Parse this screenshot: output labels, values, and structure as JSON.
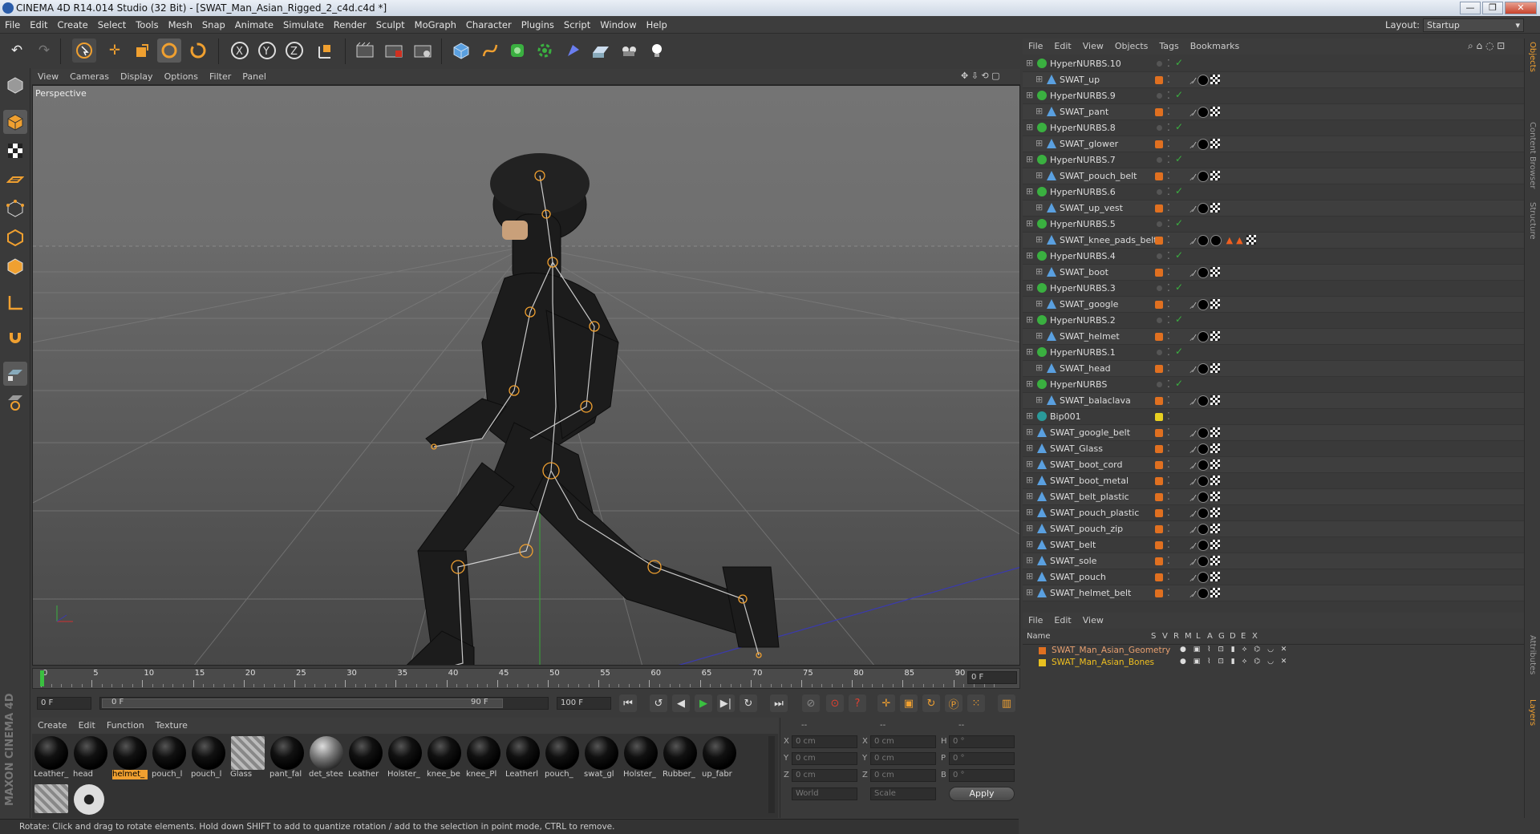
{
  "window": {
    "title": "CINEMA 4D R14.014 Studio (32 Bit) - [SWAT_Man_Asian_Rigged_2_c4d.c4d *]",
    "controls": [
      "—",
      "❐",
      "✕"
    ]
  },
  "menubar": [
    "File",
    "Edit",
    "Create",
    "Select",
    "Tools",
    "Mesh",
    "Snap",
    "Animate",
    "Simulate",
    "Render",
    "Sculpt",
    "MoGraph",
    "Character",
    "Plugins",
    "Script",
    "Window",
    "Help"
  ],
  "layout": {
    "label": "Layout:",
    "value": "Startup"
  },
  "viewport": {
    "menu": [
      "View",
      "Cameras",
      "Display",
      "Options",
      "Filter",
      "Panel"
    ],
    "label": "Perspective"
  },
  "timeline": {
    "ticks": [
      "0",
      "5",
      "10",
      "15",
      "20",
      "25",
      "30",
      "35",
      "40",
      "45",
      "50",
      "55",
      "60",
      "65",
      "70",
      "75",
      "80",
      "85",
      "90"
    ],
    "current_frame": "0 F",
    "start_field": "0 F",
    "range_start": "0 F",
    "range_end": "90 F",
    "end_field": "100 F"
  },
  "materials": {
    "menu": [
      "Create",
      "Edit",
      "Function",
      "Texture"
    ],
    "items": [
      {
        "label": "Leather_"
      },
      {
        "label": "head"
      },
      {
        "label": "helmet_",
        "selected": true
      },
      {
        "label": "pouch_l"
      },
      {
        "label": "pouch_l"
      },
      {
        "label": "Glass"
      },
      {
        "label": "pant_fal"
      },
      {
        "label": "det_stee"
      },
      {
        "label": "Leather"
      },
      {
        "label": "Holster_"
      },
      {
        "label": "knee_be"
      },
      {
        "label": "knee_Pl"
      },
      {
        "label": "Leatherl"
      },
      {
        "label": "pouch_"
      },
      {
        "label": "swat_gl"
      },
      {
        "label": "Holster_"
      },
      {
        "label": "Rubber_"
      },
      {
        "label": "up_fabr"
      }
    ]
  },
  "coords": {
    "headers": [
      "--",
      "--",
      "--"
    ],
    "rows": [
      {
        "a": "X",
        "av": "0 cm",
        "b": "X",
        "bv": "0 cm",
        "c": "H",
        "cv": "0 °"
      },
      {
        "a": "Y",
        "av": "0 cm",
        "b": "Y",
        "bv": "0 cm",
        "c": "P",
        "cv": "0 °"
      },
      {
        "a": "Z",
        "av": "0 cm",
        "b": "Z",
        "bv": "0 cm",
        "c": "B",
        "cv": "0 °"
      }
    ],
    "mode1": "World",
    "mode2": "Scale",
    "apply": "Apply"
  },
  "status": "Rotate: Click and drag to rotate elements. Hold down SHIFT to add to quantize rotation / add to the selection in point mode, CTRL to remove.",
  "object_manager": {
    "menu": [
      "File",
      "Edit",
      "View",
      "Objects",
      "Tags",
      "Bookmarks"
    ],
    "rows": [
      {
        "name": "HyperNURBS.10",
        "type": "nurbs",
        "indent": 0
      },
      {
        "name": "SWAT_up",
        "type": "poly",
        "indent": 1
      },
      {
        "name": "HyperNURBS.9",
        "type": "nurbs",
        "indent": 0
      },
      {
        "name": "SWAT_pant",
        "type": "poly",
        "indent": 1
      },
      {
        "name": "HyperNURBS.8",
        "type": "nurbs",
        "indent": 0
      },
      {
        "name": "SWAT_glower",
        "type": "poly",
        "indent": 1
      },
      {
        "name": "HyperNURBS.7",
        "type": "nurbs",
        "indent": 0
      },
      {
        "name": "SWAT_pouch_belt",
        "type": "poly",
        "indent": 1
      },
      {
        "name": "HyperNURBS.6",
        "type": "nurbs",
        "indent": 0
      },
      {
        "name": "SWAT_up_vest",
        "type": "poly",
        "indent": 1
      },
      {
        "name": "HyperNURBS.5",
        "type": "nurbs",
        "indent": 0
      },
      {
        "name": "SWAT_knee_pads_belt",
        "type": "poly",
        "indent": 1
      },
      {
        "name": "HyperNURBS.4",
        "type": "nurbs",
        "indent": 0
      },
      {
        "name": "SWAT_boot",
        "type": "poly",
        "indent": 1
      },
      {
        "name": "HyperNURBS.3",
        "type": "nurbs",
        "indent": 0
      },
      {
        "name": "SWAT_google",
        "type": "poly",
        "indent": 1
      },
      {
        "name": "HyperNURBS.2",
        "type": "nurbs",
        "indent": 0
      },
      {
        "name": "SWAT_helmet",
        "type": "poly",
        "indent": 1
      },
      {
        "name": "HyperNURBS.1",
        "type": "nurbs",
        "indent": 0
      },
      {
        "name": "SWAT_head",
        "type": "poly",
        "indent": 1
      },
      {
        "name": "HyperNURBS",
        "type": "nurbs",
        "indent": 0
      },
      {
        "name": "SWAT_balaclava",
        "type": "poly",
        "indent": 1
      },
      {
        "name": "Bip001",
        "type": "bone",
        "indent": 0
      },
      {
        "name": "SWAT_google_belt",
        "type": "poly",
        "indent": 0
      },
      {
        "name": "SWAT_Glass",
        "type": "poly",
        "indent": 0
      },
      {
        "name": "SWAT_boot_cord",
        "type": "poly",
        "indent": 0
      },
      {
        "name": "SWAT_boot_metal",
        "type": "poly",
        "indent": 0
      },
      {
        "name": "SWAT_belt_plastic",
        "type": "poly",
        "indent": 0
      },
      {
        "name": "SWAT_pouch_plastic",
        "type": "poly",
        "indent": 0
      },
      {
        "name": "SWAT_pouch_zip",
        "type": "poly",
        "indent": 0
      },
      {
        "name": "SWAT_belt",
        "type": "poly",
        "indent": 0
      },
      {
        "name": "SWAT_sole",
        "type": "poly",
        "indent": 0
      },
      {
        "name": "SWAT_pouch",
        "type": "poly",
        "indent": 0
      },
      {
        "name": "SWAT_helmet_belt",
        "type": "poly",
        "indent": 0
      }
    ]
  },
  "layer_manager": {
    "menu": [
      "File",
      "Edit",
      "View"
    ],
    "columns": [
      "Name",
      "S",
      "V",
      "R",
      "M",
      "L",
      "A",
      "G",
      "D",
      "E",
      "X"
    ],
    "layers": [
      {
        "name": "SWAT_Man_Asian_Geometry",
        "color": "#e07020"
      },
      {
        "name": "SWAT_Man_Asian_Bones",
        "color": "#e8c020"
      }
    ]
  },
  "side_tabs": [
    "Objects",
    "Content Browser",
    "Structure",
    "Attributes",
    "Layers"
  ],
  "brand": "MAXON CINEMA 4D",
  "colors": {
    "accent": "#f0a030",
    "nurbs": "#3ab040",
    "poly": "#5aa0e0",
    "layer_orange": "#e07020"
  }
}
